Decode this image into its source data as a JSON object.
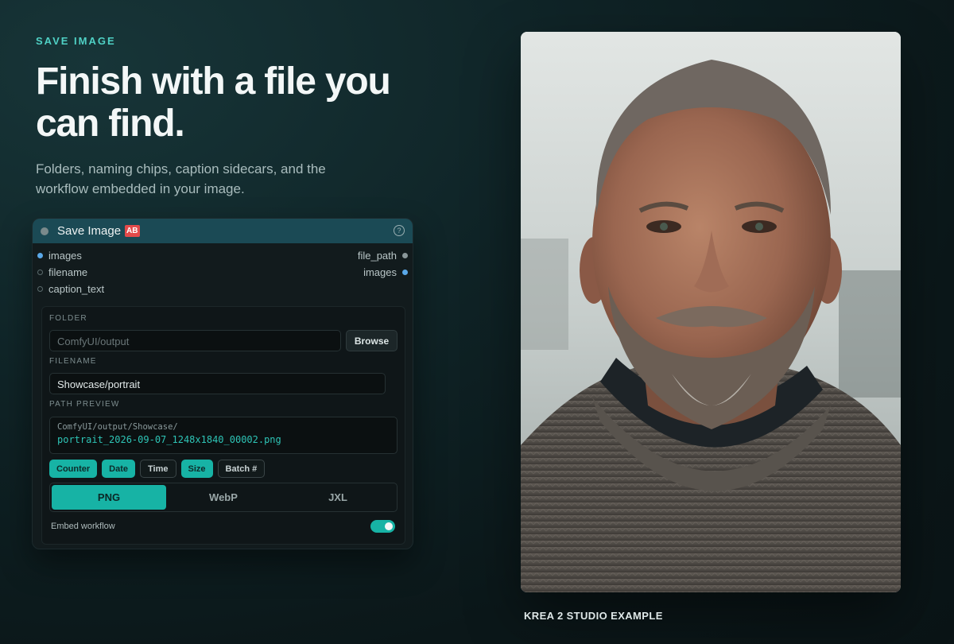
{
  "hero": {
    "eyebrow": "SAVE IMAGE",
    "headline": "Finish with a file you can find.",
    "subhead": "Folders, naming chips, caption sidecars, and the workflow embedded in your image."
  },
  "node": {
    "title": "Save Image",
    "badge": "AB",
    "help_icon": "?",
    "inputs": [
      {
        "label": "images",
        "dot": "connected"
      },
      {
        "label": "filename",
        "dot": "empty"
      },
      {
        "label": "caption_text",
        "dot": "empty"
      }
    ],
    "outputs": [
      {
        "label": "file_path",
        "dot": "grey"
      },
      {
        "label": "images",
        "dot": "connected"
      }
    ],
    "folder": {
      "label": "FOLDER",
      "placeholder": "ComfyUI/output",
      "browse_label": "Browse"
    },
    "filename": {
      "label": "FILENAME",
      "value": "Showcase/portrait"
    },
    "path_preview": {
      "label": "PATH PREVIEW",
      "dir": "ComfyUI/output/Showcase/",
      "file": "portrait_2026-09-07_1248x1840_00002.png"
    },
    "chips": [
      {
        "label": "Counter",
        "active": true
      },
      {
        "label": "Date",
        "active": true
      },
      {
        "label": "Time",
        "active": false
      },
      {
        "label": "Size",
        "active": true
      },
      {
        "label": "Batch #",
        "active": false
      }
    ],
    "formats": [
      {
        "label": "PNG",
        "active": true
      },
      {
        "label": "WebP",
        "active": false
      },
      {
        "label": "JXL",
        "active": false
      }
    ],
    "embed_workflow": {
      "label": "Embed workflow",
      "enabled": true
    }
  },
  "example": {
    "caption": "KREA 2 STUDIO EXAMPLE",
    "image_subject": "portrait-photo"
  },
  "colors": {
    "accent": "#17b3a5",
    "eyebrow": "#4fd1c5",
    "header": "#1b4a55",
    "badge": "#e34a4a",
    "connected_dot": "#5aa8e8"
  }
}
